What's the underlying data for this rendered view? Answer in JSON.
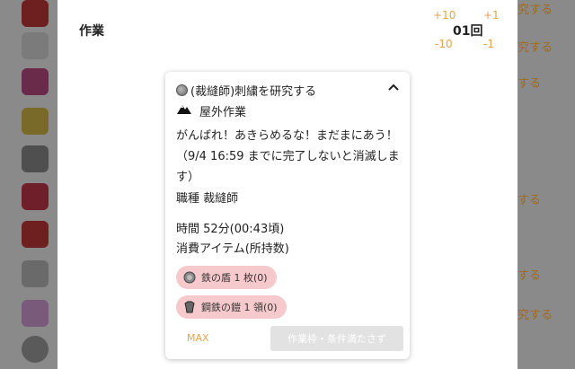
{
  "panel": {
    "title": "作業",
    "plus10": "+10",
    "plus1": "+1",
    "minus10": "-10",
    "minus1": "-1",
    "count": "01回"
  },
  "background": {
    "right_texts": [
      "究する",
      "究する",
      "する",
      "する",
      "する",
      "究する"
    ]
  },
  "task": {
    "title": "(裁縫師)刺繍を研究する",
    "location": "屋外作業",
    "message": "がんばれ！あきらめるな！まだまにあう！（9/4 16:59 までに完了しないと消滅します）",
    "job": "職種 裁縫師",
    "time": "時間 52分(00:43頃)",
    "items_heading": "消費アイテム(所持数)",
    "items": [
      {
        "label": "鉄の盾 1 枚(0)",
        "icon": "iron-shield-icon"
      },
      {
        "label": "鋼鉄の鎧 1 領(0)",
        "icon": "steel-armor-icon"
      }
    ],
    "max_label": "MAX",
    "submit_label": "作業枠・条件満たさず"
  },
  "colors": {
    "accent": "#e3a34a",
    "pill": "#f6c9cc",
    "disabled": "#e2e2e2",
    "overlay": "#8a8a8a"
  }
}
